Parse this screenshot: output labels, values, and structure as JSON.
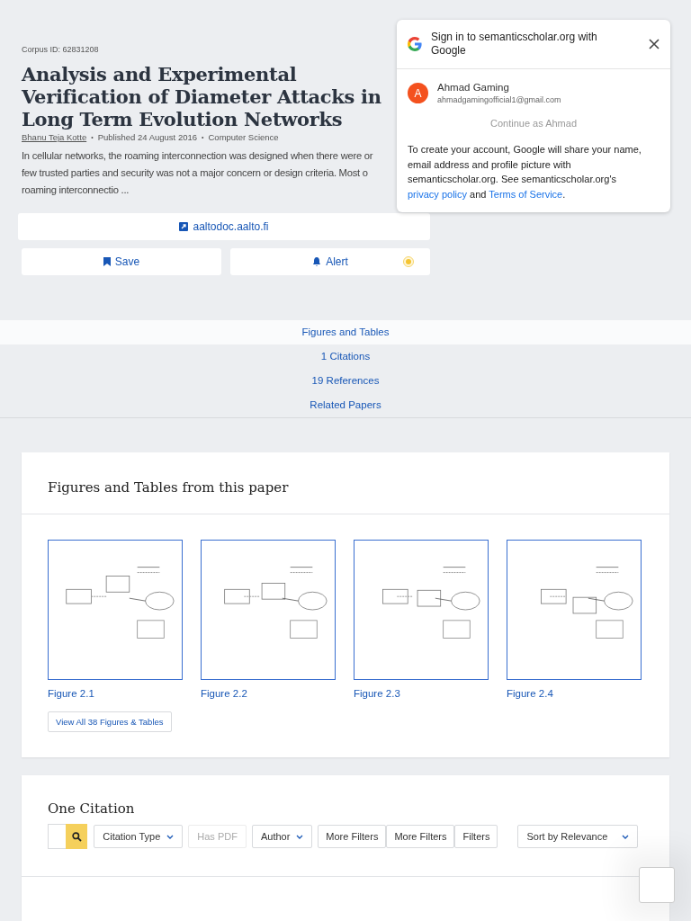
{
  "paper": {
    "corpus_id": "Corpus ID: 62831208",
    "title": "Analysis and Experimental Verification of Diameter Attacks in Long Term Evolution Networks",
    "author": "Bhanu Teja Kotte",
    "separator": "•",
    "published": "Published 24 August 2016",
    "field": "Computer Science",
    "abstract_lines": [
      "In cellular networks, the roaming interconnection was designed when there were or",
      "few trusted parties and security was not a major concern or design criteria. Most o",
      "roaming interconnectio ..."
    ]
  },
  "source_link": "aaltodoc.aalto.fi",
  "actions": [
    {
      "label": "Save",
      "kind": "save"
    },
    {
      "label": "Alert",
      "kind": "alert"
    }
  ],
  "nav": [
    {
      "label": "Figures and Tables",
      "selected": true
    },
    {
      "label": "1 Citations",
      "selected": false
    },
    {
      "label": "19 References",
      "selected": false
    },
    {
      "label": "Related Papers",
      "selected": false
    }
  ],
  "figures_section": {
    "title": "Figures and Tables from this paper",
    "figures": [
      {
        "caption": "Figure 2.1",
        "kind": "picture"
      },
      {
        "caption": "Figure 2.2",
        "kind": "picture"
      },
      {
        "caption": "Figure 2.3",
        "kind": "picture"
      },
      {
        "caption": "Figure 2.4",
        "kind": "picture"
      }
    ],
    "view_all": "View All 38 Figures & Tables"
  },
  "citations": {
    "title": "One Citation",
    "filters": [
      {
        "label": "Citation Type",
        "kind": "dropdown",
        "disabled": false
      },
      {
        "label": "Has PDF",
        "kind": "toggle",
        "disabled": true
      },
      {
        "label": "Author",
        "kind": "dropdown",
        "disabled": false
      },
      {
        "label": "More Filters",
        "kind": "plain",
        "disabled": false
      },
      {
        "label": "More Filters",
        "kind": "plain",
        "disabled": false
      },
      {
        "label": "Filters",
        "kind": "plain",
        "disabled": false
      }
    ],
    "sort": "Sort by Relevance"
  },
  "google_popup": {
    "title": "Sign in to semanticscholar.org with Google",
    "account_initial": "A",
    "account_name": "Ahmad Gaming",
    "account_email": "ahmadgamingofficial1@gmail.com",
    "continue": "Continue as Ahmad",
    "notice": "To create your account, Google will share your name, email address and profile picture with semanticscholar.org. See semanticscholar.org's",
    "privacy": "privacy policy",
    "and": "and",
    "terms": "Terms of Service",
    "end": "."
  }
}
